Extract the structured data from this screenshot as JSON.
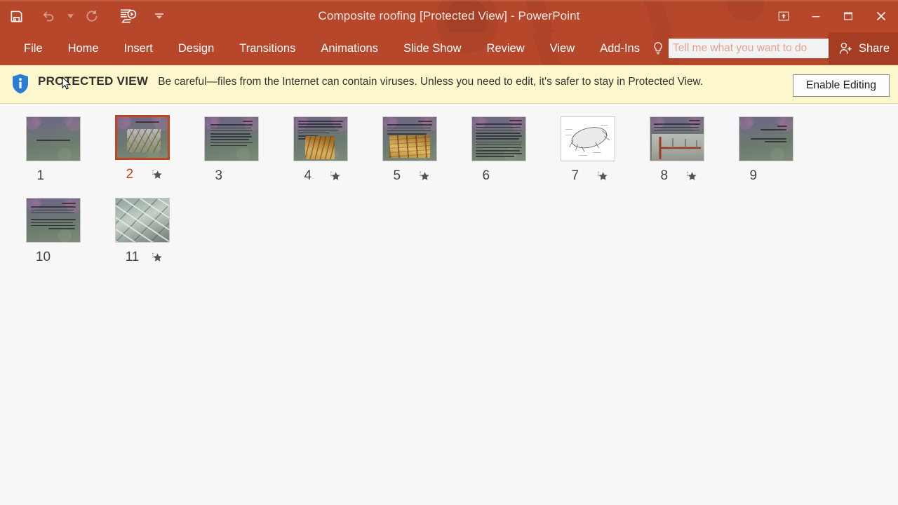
{
  "window": {
    "title": "Composite roofing [Protected View] - PowerPoint",
    "quick_access": [
      {
        "name": "save",
        "icon": "save-icon",
        "label": "Save",
        "enabled": true
      },
      {
        "name": "undo",
        "icon": "undo-icon",
        "label": "Undo",
        "enabled": false
      },
      {
        "name": "redo",
        "icon": "redo-icon",
        "label": "Redo",
        "enabled": false
      },
      {
        "name": "start-slideshow",
        "icon": "slideshow-icon",
        "label": "Start From Beginning",
        "enabled": true
      },
      {
        "name": "customize-qat",
        "icon": "chevron-down-icon",
        "label": "Customize Quick Access Toolbar",
        "enabled": true
      }
    ],
    "controls": [
      {
        "name": "ribbon-display-options",
        "icon": "ribbon-display-options-icon",
        "label": "Ribbon Display Options"
      },
      {
        "name": "minimize",
        "icon": "minimize-icon",
        "label": "Minimize"
      },
      {
        "name": "restore",
        "icon": "restore-icon",
        "label": "Restore Down"
      },
      {
        "name": "close",
        "icon": "close-icon",
        "label": "Close"
      }
    ]
  },
  "ribbon": {
    "tabs": [
      {
        "label": "File"
      },
      {
        "label": "Home"
      },
      {
        "label": "Insert"
      },
      {
        "label": "Design"
      },
      {
        "label": "Transitions"
      },
      {
        "label": "Animations"
      },
      {
        "label": "Slide Show"
      },
      {
        "label": "Review"
      },
      {
        "label": "View"
      },
      {
        "label": "Add-Ins"
      }
    ],
    "tell_me": {
      "icon": "lightbulb-icon",
      "placeholder": "Tell me what you want to do",
      "value": ""
    },
    "share": {
      "label": "Share",
      "icon": "share-person-icon"
    }
  },
  "protected_view": {
    "icon": "info-shield-icon",
    "label": "PROTECTED VIEW",
    "message": "Be careful—files from the Internet can contain viruses. Unless you need to edit, it's safer to stay in Protected View.",
    "button_label": "Enable Editing"
  },
  "slide_sorter": {
    "selected_slide": 2,
    "slides": [
      {
        "number": "1",
        "style": "title",
        "animated": false,
        "selected": false
      },
      {
        "number": "2",
        "style": "title-photo",
        "animated": true,
        "selected": true
      },
      {
        "number": "3",
        "style": "text",
        "animated": false,
        "selected": false
      },
      {
        "number": "4",
        "style": "text-photo",
        "animated": true,
        "selected": false
      },
      {
        "number": "5",
        "style": "text-photo2",
        "animated": true,
        "selected": false
      },
      {
        "number": "6",
        "style": "text-dense",
        "animated": false,
        "selected": false
      },
      {
        "number": "7",
        "style": "diagram",
        "animated": true,
        "selected": false
      },
      {
        "number": "8",
        "style": "text-photo3",
        "animated": true,
        "selected": false
      },
      {
        "number": "9",
        "style": "text-sparse",
        "animated": false,
        "selected": false
      },
      {
        "number": "10",
        "style": "text",
        "animated": false,
        "selected": false
      },
      {
        "number": "11",
        "style": "full-photo",
        "animated": true,
        "selected": false
      }
    ]
  },
  "colors": {
    "accent": "#b7472a",
    "accent_dark": "#a43d22",
    "selection": "#c0461f",
    "warning_bar": "#fdf7cd",
    "canvas": "#f7f7f7"
  }
}
